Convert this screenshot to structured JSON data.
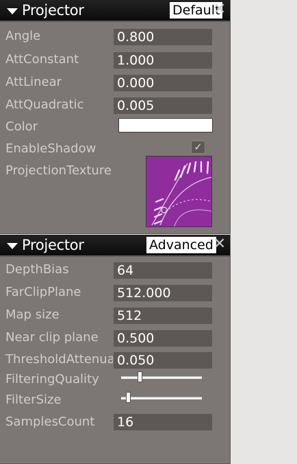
{
  "panel_default": {
    "title": "Projector",
    "preset": "Default",
    "close": "✕",
    "rows": [
      {
        "label": "Angle",
        "value": "0.800"
      },
      {
        "label": "AttConstant",
        "value": "1.000"
      },
      {
        "label": "AttLinear",
        "value": "0.000"
      },
      {
        "label": "AttQuadratic",
        "value": "0.005"
      }
    ],
    "color": {
      "label": "Color",
      "value": "#ffffff"
    },
    "enable_shadow": {
      "label": "EnableShadow",
      "checked": true,
      "check_glyph": "✓"
    },
    "projection_texture": {
      "label": "ProjectionTexture",
      "texture_text": "CALIGARI"
    }
  },
  "panel_advanced": {
    "title": "Projector",
    "preset": "Advanced",
    "close": "✕",
    "rows": [
      {
        "label": "DepthBias",
        "value": "64"
      },
      {
        "label": "FarClipPlane",
        "value": "512.000"
      },
      {
        "label": "Map size",
        "value": "512"
      },
      {
        "label": "Near clip plane",
        "value": "0.500"
      },
      {
        "label": "ThresholdAttenuation",
        "value": "0.050"
      }
    ],
    "filtering_quality": {
      "label": "FilteringQuality",
      "level": 0.22
    },
    "filter_size": {
      "label": "FilterSize",
      "level": 0.06
    },
    "samples_count": {
      "label": "SamplesCount",
      "value": "16"
    }
  },
  "colors": {
    "panel_bg": "#7c7674",
    "field_bg": "#5d5856",
    "label_text": "#d2cccb",
    "header_bg": "#111111",
    "texture_bg": "#8f2d9d"
  }
}
